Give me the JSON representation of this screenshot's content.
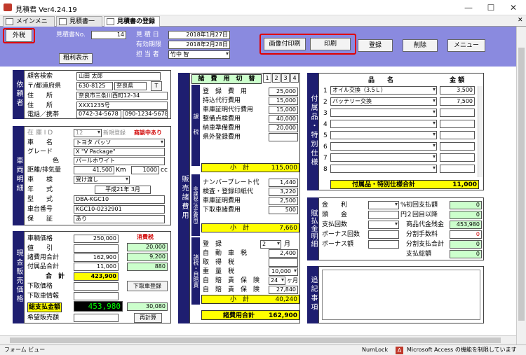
{
  "window": {
    "title": "見積君 Ver4.24.19",
    "minimize": "—",
    "maximize": "☐",
    "close": "✕"
  },
  "tabs": [
    "メインメニュー",
    "見積書一覧",
    "見積書の登録"
  ],
  "header": {
    "tax_button": "外税",
    "estimate_no_label": "見積書No.",
    "estimate_no": "14",
    "profit_button": "粗利表示",
    "date_label": "見 積 日",
    "date": "2018年1月27日",
    "valid_label": "有効期限",
    "valid": "2018年2月28日",
    "staff_label": "担 当 者",
    "staff": "竹中 智",
    "img_print": "画像付印刷",
    "print": "印刷",
    "register": "登録",
    "delete": "削除",
    "menu": "メニュー"
  },
  "client": {
    "section": "依頼者",
    "search_label": "顧客検索",
    "search": "山田 太郎",
    "pref_label": "〒/都道府県",
    "zip": "630-8125",
    "pref": "奈良県",
    "t_btn": "T",
    "addr_label": "住　　所",
    "addr1": "奈良市三条川西町12-34",
    "addr2": "XXX1235号",
    "tel_label": "電話／携帯",
    "tel": "0742-34-5678",
    "mobile": "090-1234-5678"
  },
  "vehicle": {
    "section": "車両明細",
    "stock_label": "在 庫 I D",
    "stock": "12",
    "new_btn": "新規登録",
    "stock_status": "商談中あり",
    "name_label": "車　　名",
    "name": "トヨタ パッソ",
    "grade_label": "グレード",
    "grade": "X \"V Package\"",
    "color_label": "色",
    "color": "パールホワイト",
    "dist_label": "距離/排気量",
    "dist": "41,500",
    "dist_unit": "Km",
    "cc": "1000",
    "cc_unit": "cc",
    "inspect_label": "車　　検",
    "inspect": "受け渡し",
    "year_label": "年　　式",
    "year": "平成21年 3月",
    "model_label": "型　　式",
    "model": "DBA-KGC10",
    "chassis_label": "車台番号",
    "chassis": "KGC10-0232901",
    "warranty_label": "保　　証",
    "warranty": "あり"
  },
  "price": {
    "section": "現金販売価格",
    "tax_header": "消費税",
    "vehicle_label": "車輌価格",
    "vehicle": "250,000",
    "discount_label": "値　　引",
    "discount_tax": "20,000",
    "fees_label": "諸費用合計",
    "fees": "162,900",
    "fees_tax": "9,200",
    "acc_label": "付属品合計",
    "acc": "11,000",
    "acc_tax": "880",
    "total_label": "合　計",
    "total": "423,900",
    "trade_label": "下取価格",
    "trade_btn": "下取車登録",
    "trade_car_label": "下取車情報",
    "grand_label": "総支払金額",
    "grand": "453,980",
    "grand_tax": "30,080",
    "hope_label": "希望販売額",
    "recalc_btn": "再計算"
  },
  "fees": {
    "section": "販売諸費用",
    "header": "諸　費　用　切　替",
    "tabs": [
      "1",
      "2",
      "3",
      "4"
    ],
    "taxable_side": "課　税",
    "items": [
      {
        "label": "登　録　費　用",
        "value": "25,000"
      },
      {
        "label": "持込代行費用",
        "value": "15,000"
      },
      {
        "label": "車庫証明代行費用",
        "value": "15,000"
      },
      {
        "label": "整備点検費用",
        "value": "40,000"
      },
      {
        "label": "納車準備費用",
        "value": "20,000"
      },
      {
        "label": "県外登録費用",
        "value": ""
      }
    ],
    "subtotal1_label": "小　計",
    "subtotal1": "115,000",
    "nontax_side": "非課税(法定費用)",
    "nontax": [
      {
        "label": "ナンバープレート代",
        "value": "1,440"
      },
      {
        "label": "検査・登録印紙代",
        "value": "3,220"
      },
      {
        "label": "車庫証明費用",
        "value": "2,500"
      },
      {
        "label": "下取車諸費用",
        "value": "500"
      }
    ],
    "subtotal2_label": "小　計",
    "subtotal2": "7,660",
    "taxes_side": "諸税・自賠責",
    "reg_label": "登　録",
    "reg_mo": "2",
    "reg_unit": "月",
    "car_tax_label": "自　動　車　税",
    "car_tax": "2,400",
    "acq_label": "取　得　税",
    "acq": "",
    "weight_label": "重　量　税",
    "weight": "10,000",
    "ins_label": "自　賠　責　保　険",
    "ins_mo": "24",
    "ins_unit": "ヶ月",
    "ins": "27,840",
    "ins2_label": "自　賠　責　保　険",
    "ins2": "",
    "subtotal3_label": "小　計",
    "subtotal3": "40,240",
    "total_label": "諸費用合計",
    "total": "162,900"
  },
  "accessories": {
    "section": "付属品・特別仕様",
    "name_header": "品　　名",
    "amount_header": "金 額",
    "rows": [
      {
        "no": "1",
        "name": "オイル交換（3.5Ｌ）",
        "amount": "3,500"
      },
      {
        "no": "2",
        "name": "バッテリー交換",
        "amount": "7,500"
      },
      {
        "no": "3",
        "name": "",
        "amount": ""
      },
      {
        "no": "4",
        "name": "",
        "amount": ""
      },
      {
        "no": "5",
        "name": "",
        "amount": ""
      },
      {
        "no": "6",
        "name": "",
        "amount": ""
      },
      {
        "no": "7",
        "name": "",
        "amount": ""
      },
      {
        "no": "8",
        "name": "",
        "amount": ""
      }
    ],
    "total_label": "付属品・特別仕様合計",
    "total": "11,000"
  },
  "payment": {
    "section": "賦払金明細",
    "rate_label": "金　　利",
    "rate_unit": "%",
    "down_label": "頭　　金",
    "down_unit": "円",
    "count_label": "支払回数",
    "bonus_count_label": "ボーナス回数",
    "bonus_label": "ボーナス額",
    "first_label": "初回支払額",
    "first": "0",
    "second_label": "２回目以降",
    "second": "0",
    "balance_label": "商品代金残金",
    "balance": "453,980",
    "fee_label": "分割手数料",
    "fee": "0",
    "sum_label": "分割支払合計",
    "sum": "0",
    "all_label": "支払総額",
    "all": "0"
  },
  "notes": {
    "section": "追記事項"
  },
  "status": {
    "left": "フォーム ビュー",
    "numlock": "NumLock",
    "access": "Microsoft Access の機能を制限しています"
  },
  "colors": {
    "header": "#8a8adf",
    "section": "#1e1e70",
    "total_bg": "#ffff00",
    "tax_bg": "#ccffcc"
  }
}
